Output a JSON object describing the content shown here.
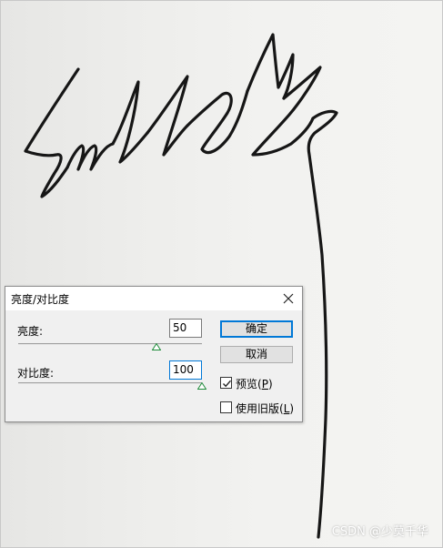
{
  "dialog": {
    "title": "亮度/对比度",
    "brightness": {
      "label": "亮度:",
      "value": "50",
      "slider_position": 0.75
    },
    "contrast": {
      "label": "对比度:",
      "value": "100",
      "slider_position": 1.0
    },
    "ok_label": "确定",
    "cancel_label": "取消",
    "preview": {
      "label": "预览(",
      "accel": "P",
      "suffix": ")",
      "checked": true
    },
    "legacy": {
      "label": "使用旧版(",
      "accel": "L",
      "suffix": ")",
      "checked": false
    },
    "close_icon": "close-icon",
    "accent_color": "#0078d7",
    "thumb_color": "#1e8c3a"
  },
  "watermark": "CSDN @少莫千华"
}
